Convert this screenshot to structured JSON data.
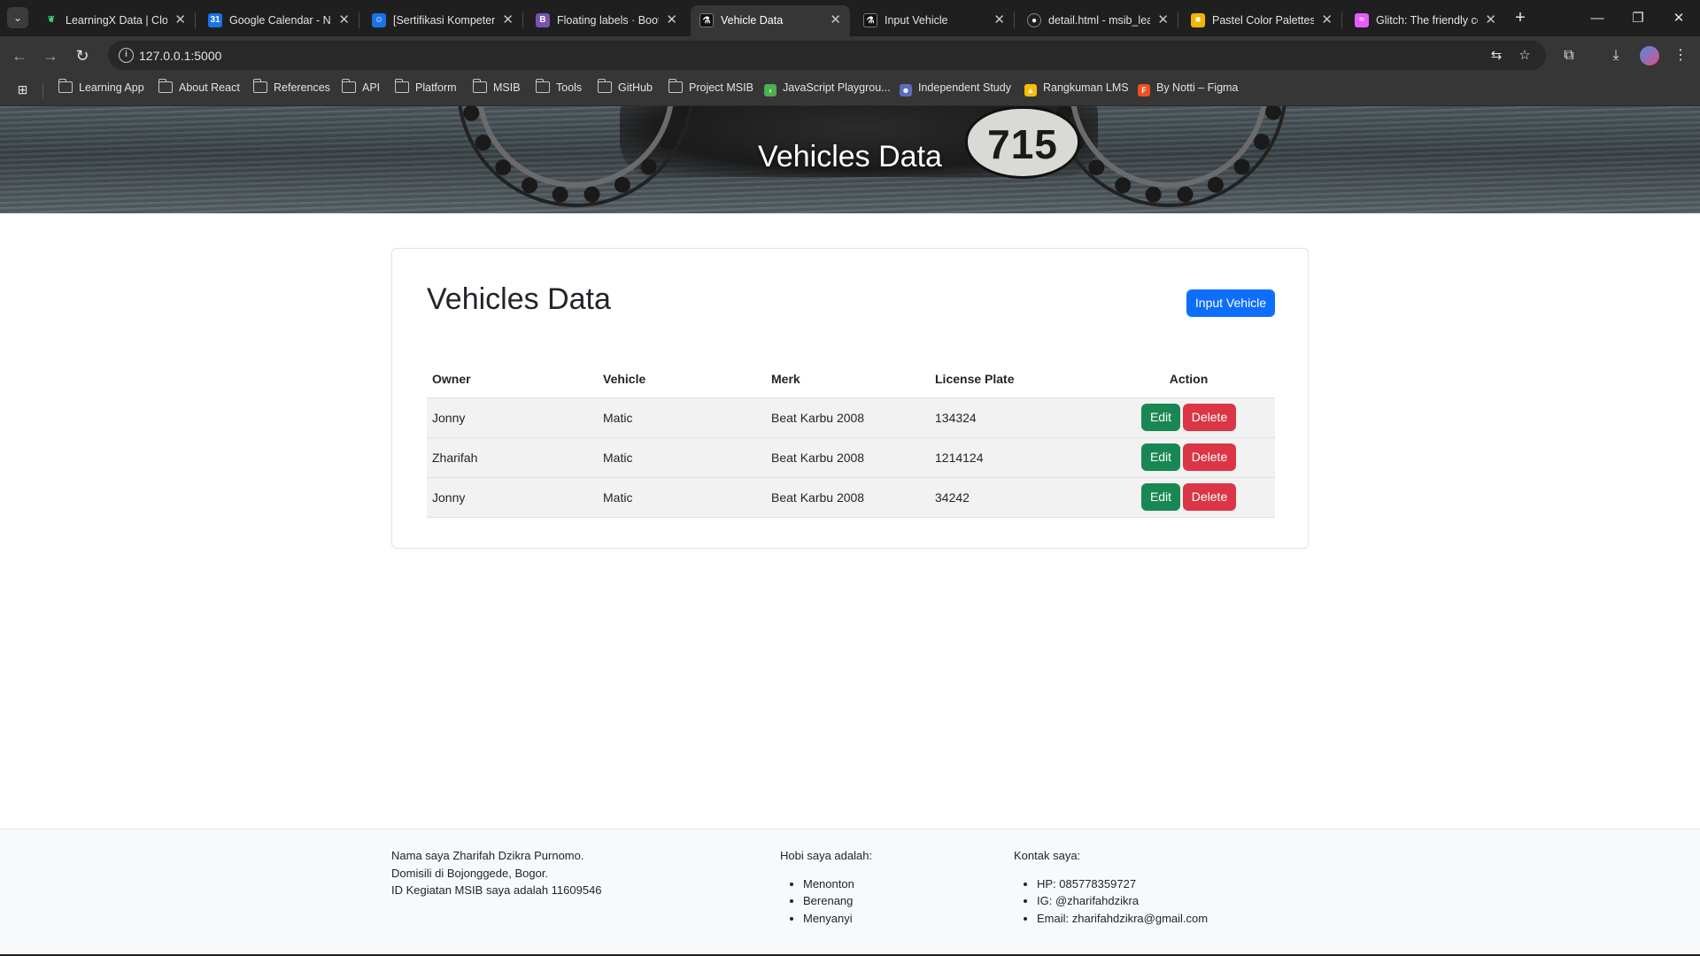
{
  "browser": {
    "tabs": [
      {
        "title": "LearningX Data | Cloud",
        "favicon_color": "#1f1f1f",
        "favicon_glyph": "leaf-icon"
      },
      {
        "title": "Google Calendar - Nov",
        "favicon_color": "#1a73e8",
        "favicon_glyph": "calendar-icon"
      },
      {
        "title": "[Sertifikasi Kompetensi",
        "favicon_color": "#1a73e8",
        "favicon_glyph": "person-icon"
      },
      {
        "title": "Floating labels · Bootstrap",
        "favicon_color": "#7952b3",
        "favicon_glyph": "bootstrap-icon"
      },
      {
        "title": "Vehicle Data",
        "favicon_color": "#111111",
        "favicon_glyph": "flask-icon",
        "active": true
      },
      {
        "title": "Input Vehicle",
        "favicon_color": "#111111",
        "favicon_glyph": "flask-icon"
      },
      {
        "title": "detail.html - msib_learn",
        "favicon_color": "#1f1f1f",
        "favicon_glyph": "github-icon"
      },
      {
        "title": "Pastel Color Palettes",
        "favicon_color": "#f4b400",
        "favicon_glyph": "palette-icon"
      },
      {
        "title": "Glitch: The friendly comm",
        "favicon_color": "#e55cff",
        "favicon_glyph": "glitch-icon"
      }
    ],
    "address": {
      "url": "127.0.0.1:5000"
    },
    "bookmarks": [
      {
        "label": "Learning App",
        "type": "folder"
      },
      {
        "label": "About React",
        "type": "folder"
      },
      {
        "label": "References",
        "type": "folder"
      },
      {
        "label": "API",
        "type": "folder"
      },
      {
        "label": "Platform",
        "type": "folder"
      },
      {
        "label": "MSIB",
        "type": "folder"
      },
      {
        "label": "Tools",
        "type": "folder"
      },
      {
        "label": "GitHub",
        "type": "folder"
      },
      {
        "label": "Project MSIB",
        "type": "folder"
      },
      {
        "label": "JavaScript Playgrou...",
        "type": "site",
        "icon_color": "#4caf50"
      },
      {
        "label": "Independent Study",
        "type": "site",
        "icon_color": "#5c6bc0"
      },
      {
        "label": "Rangkuman LMS",
        "type": "site",
        "icon_color": "#fbbc04"
      },
      {
        "label": "By Notti – Figma",
        "type": "site",
        "icon_color": "#f24e1e"
      }
    ]
  },
  "hero": {
    "title": "Vehicles Data",
    "plate_number": "715"
  },
  "card": {
    "title": "Vehicles Data",
    "input_button_label": "Input Vehicle",
    "table": {
      "headers": {
        "owner": "Owner",
        "vehicle": "Vehicle",
        "merk": "Merk",
        "plate": "License Plate",
        "action": "Action"
      },
      "rows": [
        {
          "owner": "Jonny",
          "vehicle": "Matic",
          "merk": "Beat Karbu 2008",
          "plate": "134324"
        },
        {
          "owner": "Zharifah",
          "vehicle": "Matic",
          "merk": "Beat Karbu 2008",
          "plate": "1214124"
        },
        {
          "owner": "Jonny",
          "vehicle": "Matic",
          "merk": "Beat Karbu 2008",
          "plate": "34242"
        }
      ],
      "edit_label": "Edit",
      "delete_label": "Delete"
    }
  },
  "footer": {
    "about": [
      "Nama saya Zharifah Dzikra Purnomo.",
      "Domisili di Bojonggede, Bogor.",
      "ID Kegiatan MSIB saya adalah 11609546"
    ],
    "hobbies_title": "Hobi saya adalah:",
    "hobbies": [
      "Menonton",
      "Berenang",
      "Menyanyi"
    ],
    "contact_title": "Kontak saya:",
    "contacts": [
      "HP: 085778359727",
      "IG: @zharifahdzikra",
      "Email: zharifahdzikra@gmail.com"
    ]
  },
  "colors": {
    "primary": "#0d6efd",
    "success": "#198754",
    "danger": "#dc3545",
    "chrome_dark": "#1f1f1f",
    "chrome_toolbar": "#363636"
  }
}
